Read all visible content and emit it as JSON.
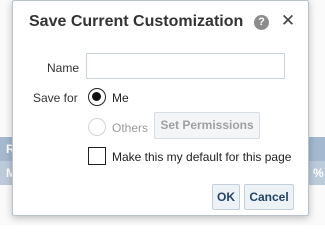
{
  "background": {
    "band1_left": "R",
    "band2_left": "M",
    "band2_right": "%"
  },
  "dialog": {
    "title": "Save Current Customization",
    "help_icon": "?",
    "close_icon": "✕"
  },
  "form": {
    "name_label": "Name",
    "name_value": "",
    "name_placeholder": "",
    "save_for_label": "Save for",
    "options": [
      {
        "label": "Me",
        "selected": true,
        "enabled": true
      },
      {
        "label": "Others",
        "selected": false,
        "enabled": false
      }
    ],
    "set_permissions_label": "Set Permissions",
    "default_checkbox_label": "Make this my default for this page",
    "default_checked": false
  },
  "buttons": {
    "ok_label": "OK",
    "cancel_label": "Cancel"
  },
  "colors": {
    "accent": "#224466",
    "disabled_text": "#9a9a9a"
  }
}
